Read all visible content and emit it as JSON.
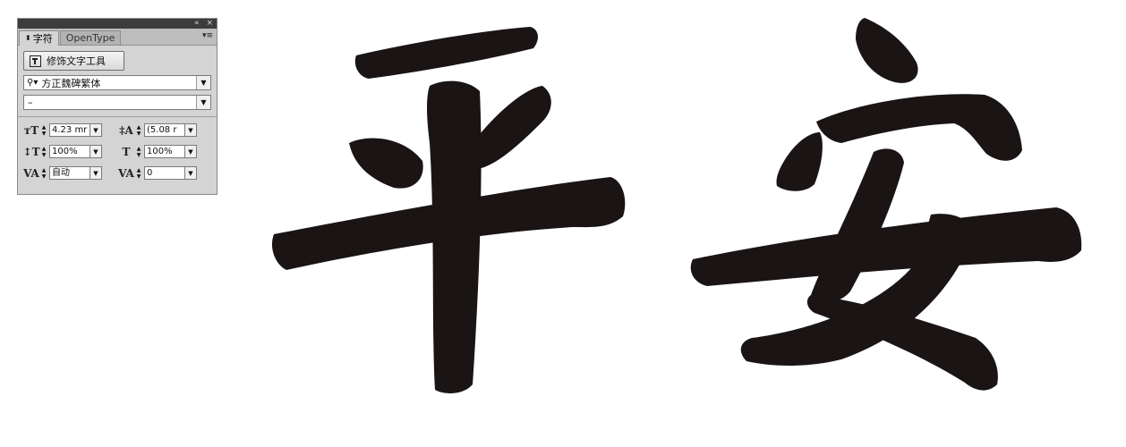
{
  "panel": {
    "titlebar": {
      "collapse_icon": "collapse-icon",
      "close_icon": "close-icon"
    },
    "tabs": [
      {
        "label": "字符",
        "active": true
      },
      {
        "label": "OpenType",
        "active": false
      }
    ],
    "decorative_text_tool_label": "修饰文字工具",
    "font_family": "方正魏碑繁体",
    "font_style": "–",
    "fields": {
      "font_size": "4.23 mr",
      "leading": "(5.08 r",
      "vertical_scale": "100%",
      "horizontal_scale": "100%",
      "kerning": "自动",
      "tracking": "0"
    }
  },
  "artwork": {
    "characters": [
      "平",
      "安"
    ],
    "color": "#1a1414"
  }
}
